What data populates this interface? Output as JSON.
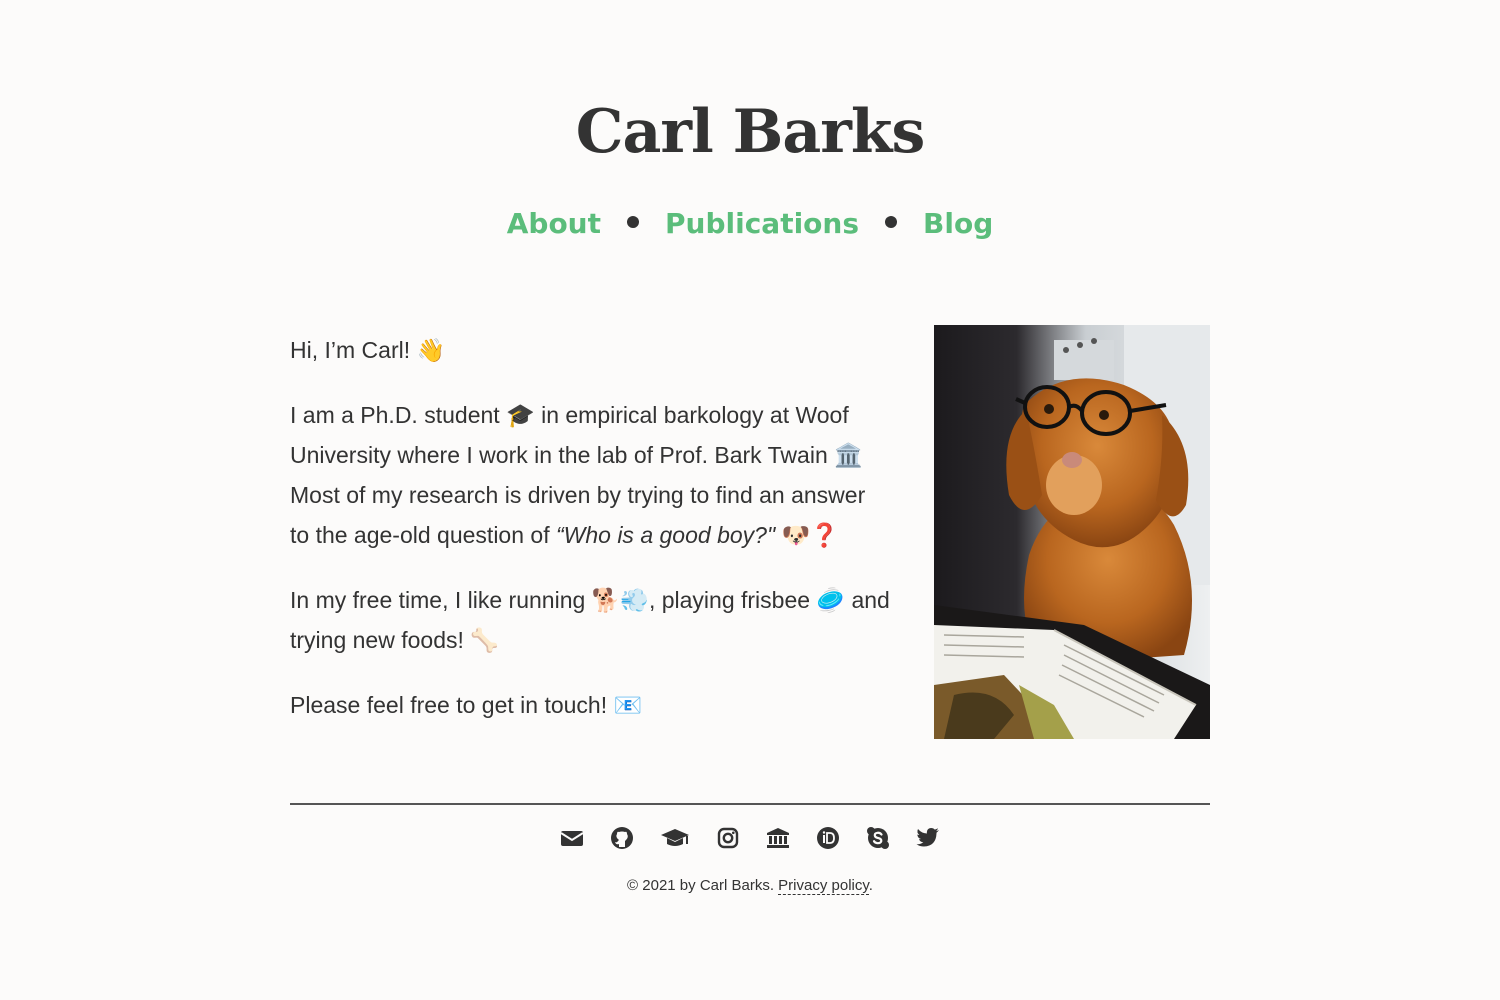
{
  "header": {
    "title": "Carl Barks"
  },
  "nav": {
    "items": [
      {
        "label": "About"
      },
      {
        "label": "Publications"
      },
      {
        "label": "Blog"
      }
    ]
  },
  "bio": {
    "greeting": "Hi, I’m Carl! 👋",
    "p1_a": "I am a Ph.D. student 🎓 in empirical barkology at Woof University where I work in the lab of Prof. Bark Twain 🏛️ Most of my research is driven by trying to find an answer to the age-old question of ",
    "p1_quote": "“Who is a good boy?\"",
    "p1_b": " 🐶❓",
    "p2": "In my free time, I like running 🐕💨, playing frisbee 🥏 and trying new foods! 🦴",
    "p3": "Please feel free to get in touch! 📧"
  },
  "social": {
    "icons": [
      "email-icon",
      "github-icon",
      "graduation-cap-icon",
      "instagram-icon",
      "university-icon",
      "orcid-icon",
      "skype-icon",
      "twitter-icon"
    ]
  },
  "footer": {
    "copyright": "© 2021 by Carl Barks.",
    "privacy_label": "Privacy policy",
    "period": "."
  },
  "colors": {
    "accent": "#5bbd7b",
    "background": "#fcfbfa",
    "text": "#333333"
  }
}
